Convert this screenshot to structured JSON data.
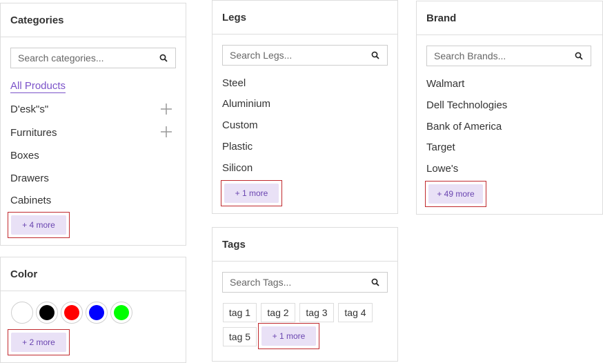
{
  "categories": {
    "title": "Categories",
    "search_placeholder": "Search categories...",
    "active_item": "All Products",
    "items": [
      "D'esk\"s\"",
      "Furnitures",
      "Boxes",
      "Drawers",
      "Cabinets"
    ],
    "more_label": "+ 4 more"
  },
  "color": {
    "title": "Color",
    "swatches": [
      "#ffffff",
      "#000000",
      "#ff0000",
      "#0000ff",
      "#00ff00"
    ],
    "more_label": "+ 2 more"
  },
  "legs": {
    "title": "Legs",
    "search_placeholder": "Search Legs...",
    "items": [
      "Steel",
      "Aluminium",
      "Custom",
      "Plastic",
      "Silicon"
    ],
    "more_label": "+ 1 more"
  },
  "tags": {
    "title": "Tags",
    "search_placeholder": "Search Tags...",
    "items": [
      "tag 1",
      "tag 2",
      "tag 3",
      "tag 4",
      "tag 5"
    ],
    "more_label": "+ 1 more"
  },
  "brand": {
    "title": "Brand",
    "search_placeholder": "Search Brands...",
    "items": [
      "Walmart",
      "Dell Technologies",
      "Bank of America",
      "Target",
      "Lowe's"
    ],
    "more_label": "+ 49 more"
  },
  "colors": {
    "accent": "#7b52c9",
    "more_bg": "#e9e1f6",
    "highlight_border": "#c0282d"
  }
}
